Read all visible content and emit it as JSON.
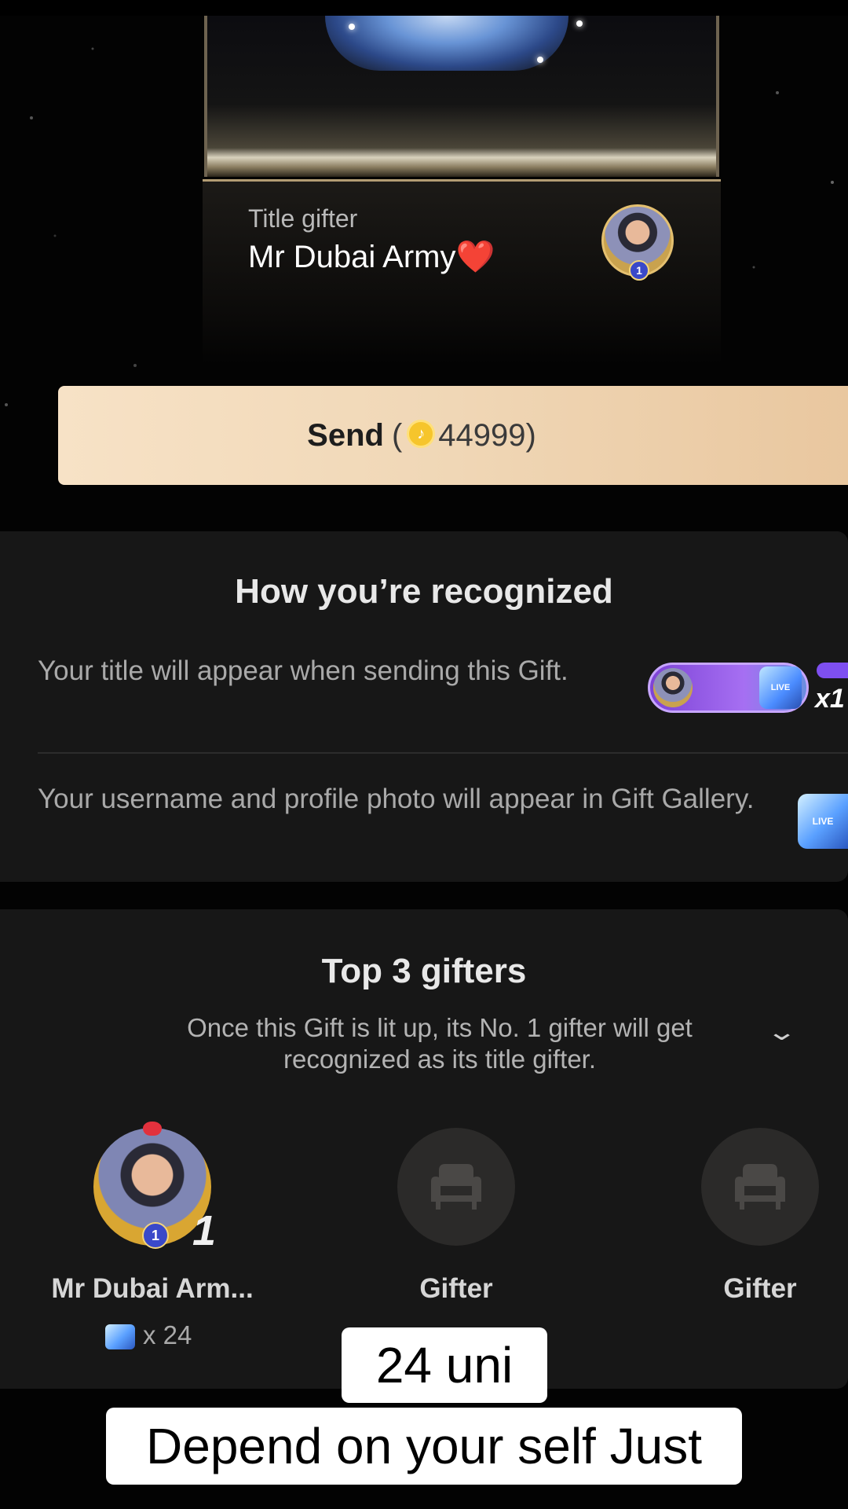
{
  "title_card": {
    "label": "Title gifter",
    "name": "Mr Dubai Army",
    "heart": "❤️",
    "rank": "1"
  },
  "send_button": {
    "label": "Send",
    "open_paren": "(",
    "coin_icon": "coin-icon",
    "amount": "44999",
    "close_paren": ")"
  },
  "recognition": {
    "title": "How you’re recognized",
    "rows": [
      {
        "text": "Your title will appear when sending this Gift.",
        "badge_multiplier": "x1"
      },
      {
        "text": "Your username and profile photo will appear in Gift Gallery."
      }
    ]
  },
  "top_gifters": {
    "title": "Top 3 gifters",
    "subtitle": "Once this Gift is lit up, its No. 1 gifter will get recognized as its title gifter.",
    "gifters": [
      {
        "name": "Mr Dubai Arm...",
        "rank": "1",
        "count": "x 24",
        "rank_mark": "1"
      },
      {
        "name": "Gifter"
      },
      {
        "name": "Gifter"
      }
    ]
  },
  "captions": {
    "line1": "24 uni",
    "line2": "Depend on your self Just"
  },
  "colors": {
    "send_button": "#f0d7b6",
    "card_bg": "#171717",
    "banner_purple": "#7d43d6",
    "heart": "#e01b2d"
  }
}
